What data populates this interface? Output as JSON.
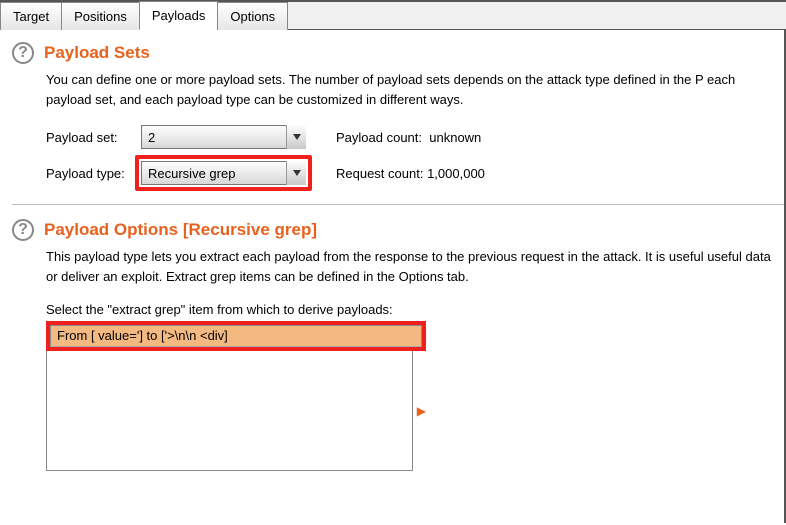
{
  "tabs": {
    "target": "Target",
    "positions": "Positions",
    "payloads": "Payloads",
    "options": "Options"
  },
  "payloadSets": {
    "title": "Payload Sets",
    "desc": "You can define one or more payload sets. The number of payload sets depends on the attack type defined in the P each payload set, and each payload type can be customized in different ways.",
    "setLabel": "Payload set:",
    "setValue": "2",
    "typeLabel": "Payload type:",
    "typeValue": "Recursive grep",
    "countLabel": "Payload count:",
    "countValue": "unknown",
    "reqLabel": "Request count:",
    "reqValue": "1,000,000"
  },
  "payloadOptions": {
    "title": "Payload Options [Recursive grep]",
    "desc": "This payload type lets you extract each payload from the response to the previous request in the attack. It is useful useful data or deliver an exploit. Extract grep items can be defined in the Options tab.",
    "selectLabel": "Select the \"extract grep\" item from which to derive payloads:",
    "tableHeader": "From [ value='] to ['>\\n\\n            <div]"
  }
}
